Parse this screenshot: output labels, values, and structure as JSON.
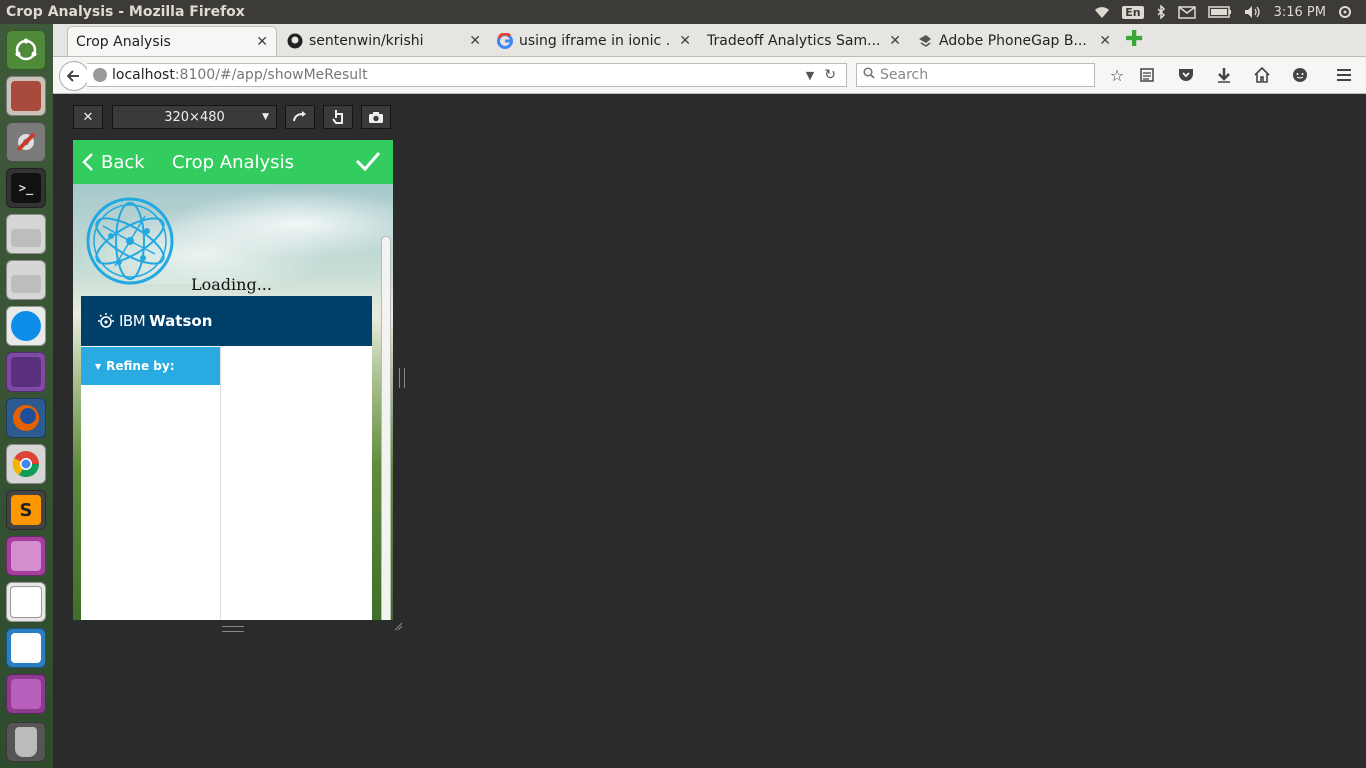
{
  "window": {
    "title": "Crop Analysis - Mozilla Firefox"
  },
  "system_tray": {
    "keyboard_lang": "En",
    "clock": "3:16 PM"
  },
  "tabs": [
    {
      "label": "Crop Analysis",
      "active": true
    },
    {
      "label": "sentenwin/krishi",
      "active": false
    },
    {
      "label": "using iframe in ionic ...",
      "active": false
    },
    {
      "label": "Tradeoff Analytics Sam...",
      "active": false
    },
    {
      "label": "Adobe PhoneGap B...",
      "active": false
    }
  ],
  "address_bar": {
    "host": "localhost",
    "path": ":8100/#/app/showMeResult"
  },
  "search": {
    "placeholder": "Search"
  },
  "responsive_toolbar": {
    "size_label": "320×480"
  },
  "app": {
    "header": {
      "back_label": "Back",
      "title": "Crop Analysis"
    },
    "loading_text": "Loading...",
    "ibm_bar": {
      "ibm": "IBM",
      "watson": "Watson"
    },
    "refine": {
      "label": "Refine by:"
    }
  },
  "colors": {
    "app_header": "#33cd5f",
    "ibm_bar": "#003f69",
    "refine_header": "#29abe2"
  }
}
